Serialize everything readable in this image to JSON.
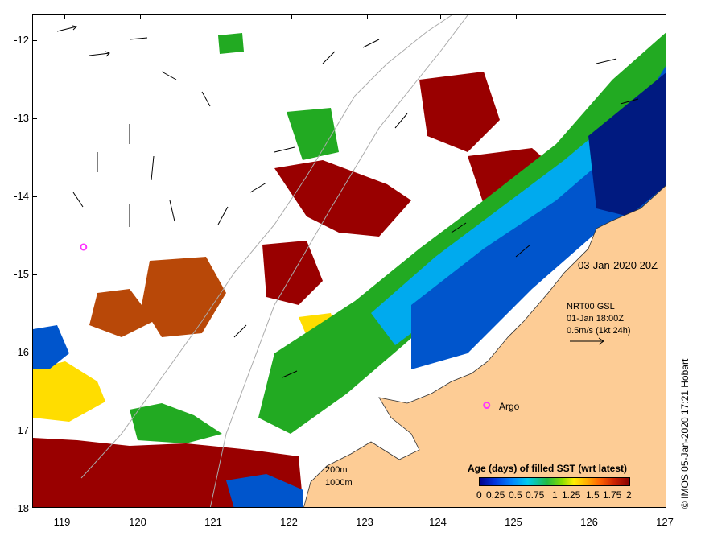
{
  "map": {
    "date_label": "03-Jan-2020 20Z",
    "product_label": "NRT00 GSL",
    "product_time": "01-Jan 18:00Z",
    "current_scale_label": "0.5m/s (1kt 24h)",
    "argo_label": "Argo",
    "depth_labels": [
      "200m",
      "1000m"
    ],
    "copyright": "© IMOS 05-Jan-2020 17:21 Hobart",
    "lon_ticks": [
      "119",
      "120",
      "121",
      "122",
      "123",
      "124",
      "125",
      "126",
      "127"
    ],
    "lat_ticks": [
      "-12",
      "-13",
      "-14",
      "-15",
      "-16",
      "-17",
      "-18"
    ],
    "lon_range": [
      118.6,
      127.0
    ],
    "lat_range": [
      -18.0,
      -11.7
    ],
    "argo_floats": [
      {
        "lon": 119.28,
        "lat": -14.67
      },
      {
        "lon": 124.62,
        "lat": -16.69
      }
    ]
  },
  "colorbar": {
    "title": "Age (days) of filled SST (wrt latest)",
    "tick_labels": [
      "0",
      "0.25",
      "0.5",
      "0.75",
      "1",
      "1.25",
      "1.5",
      "1.75",
      "2"
    ],
    "range": [
      0,
      2
    ]
  },
  "colors": {
    "land": "#fdcc95",
    "coastline": "#333333",
    "bathymetry": "#aaaaaa",
    "argo": "#ff33ff",
    "age_dark_red": "#990000",
    "age_brown": "#b84808",
    "age_orange": "#ee8800",
    "age_yellow": "#ffdd00",
    "age_green": "#22aa22",
    "age_cyan": "#00aaee",
    "age_blue": "#0055cc",
    "age_navy": "#001a80"
  }
}
